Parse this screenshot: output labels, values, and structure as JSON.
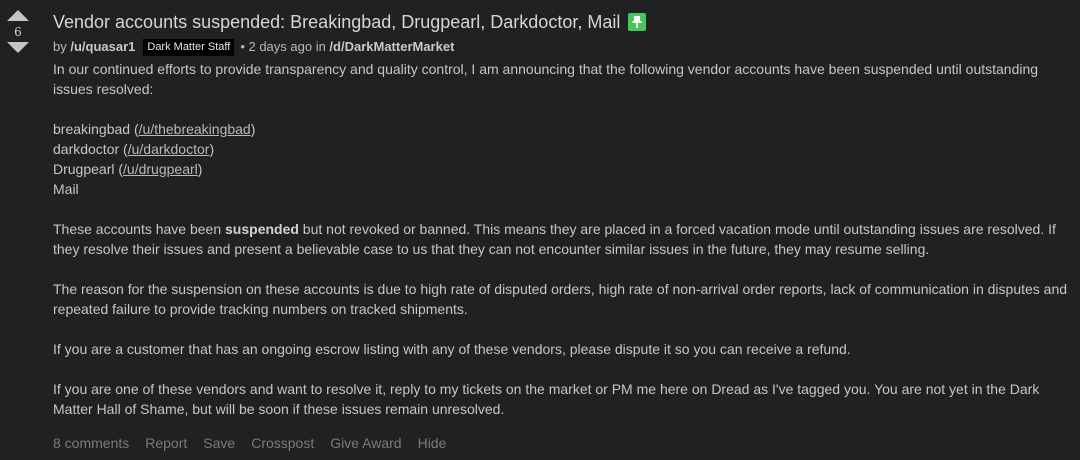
{
  "vote": {
    "score": "6",
    "upvote_icon": "upvote-arrow-icon",
    "downvote_icon": "downvote-arrow-icon"
  },
  "post": {
    "title": "Vendor accounts suspended: Breakingbad, Drugpearl, Darkdoctor, Mail",
    "pin_icon": "pin-icon",
    "pin_color": "#46c65b"
  },
  "meta": {
    "by": "by ",
    "author": "/u/quasar1",
    "flair": "Dark Matter Staff",
    "time": "• 2 days ago in ",
    "subreddit": "/d/DarkMatterMarket"
  },
  "body": {
    "intro": "In our continued efforts to provide transparency and quality control, I am announcing that the following vendor accounts have been suspended until outstanding issues resolved:",
    "vendors": [
      {
        "name": "breakingbad",
        "link": "/u/thebreakingbad"
      },
      {
        "name": "darkdoctor",
        "link": "/u/darkdoctor"
      },
      {
        "name": "Drugpearl",
        "link": "/u/drugpearl"
      }
    ],
    "vendor_mail": "Mail",
    "para_suspended_pre": "These accounts have been ",
    "para_suspended_bold": "suspended",
    "para_suspended_post": " but not revoked or banned. This means they are placed in a forced vacation mode until outstanding issues are resolved. If they resolve their issues and present a believable case to us that they can not encounter similar issues in the future, they may resume selling.",
    "para_reason": "The reason for the suspension on these accounts is due to high rate of disputed orders, high rate of non-arrival order reports, lack of communication in disputes and repeated failure to provide tracking numbers on tracked shipments.",
    "para_customer": "If you are a customer that has an ongoing escrow listing with any of these vendors, please dispute it so you can receive a refund.",
    "para_vendor": "If you are one of these vendors and want to resolve it, reply to my tickets on the market or PM me here on Dread as I've tagged you. You are not yet in the Dark Matter Hall of Shame, but will be soon if these issues remain unresolved."
  },
  "actions": {
    "comments": "8 comments",
    "report": "Report",
    "save": "Save",
    "crosspost": "Crosspost",
    "give_award": "Give Award",
    "hide": "Hide"
  }
}
